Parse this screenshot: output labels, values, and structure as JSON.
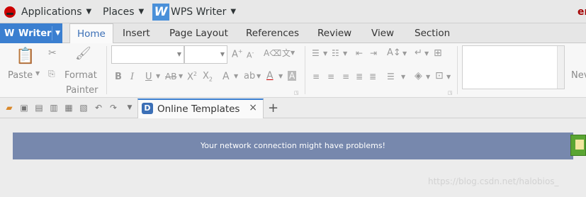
{
  "panel": {
    "applications": "Applications",
    "places": "Places",
    "window_title": "WPS Writer",
    "user_partial": "er"
  },
  "app": {
    "writer_label": "Writer"
  },
  "tabs": [
    "Home",
    "Insert",
    "Page Layout",
    "References",
    "Review",
    "View",
    "Section"
  ],
  "ribbon": {
    "paste": "Paste",
    "format": "Format",
    "painter": "Painter",
    "new_partial": "Nev",
    "font_name": "",
    "font_size": ""
  },
  "doc_tab": {
    "label": "Online Templates",
    "close": "×",
    "add": "+"
  },
  "banner": {
    "message": "Your network connection might have problems!"
  },
  "watermark": "https://blog.csdn.net/halobios_",
  "colors": {
    "accent": "#3b7fd0",
    "banner": "#7788ad",
    "active_tab_text": "#3b6fb6"
  }
}
